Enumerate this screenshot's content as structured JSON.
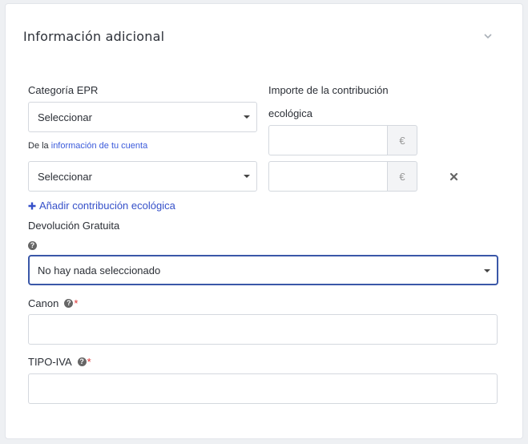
{
  "section": {
    "title": "Información adicional"
  },
  "epr": {
    "category_label": "Categoría EPR",
    "select_1_value": "Seleccionar",
    "note_prefix": "De la ",
    "note_link": "información de tu cuenta",
    "select_2_value": "Seleccionar"
  },
  "eco": {
    "amount_label_line1": "Importe de la contribución",
    "amount_label_line2": "ecológica",
    "currency_symbol": "€",
    "add_label": "Añadir contribución ecológica"
  },
  "return": {
    "label": "Devolución Gratuita",
    "select_value": "No hay nada seleccionado"
  },
  "canon": {
    "label": "Canon",
    "required": "*"
  },
  "tipo_iva": {
    "label": "TIPO-IVA",
    "required": "*"
  },
  "help_glyph": "?",
  "colors": {
    "accent": "#3a57a8",
    "link": "#3b5bdb",
    "required": "#dd3333"
  }
}
